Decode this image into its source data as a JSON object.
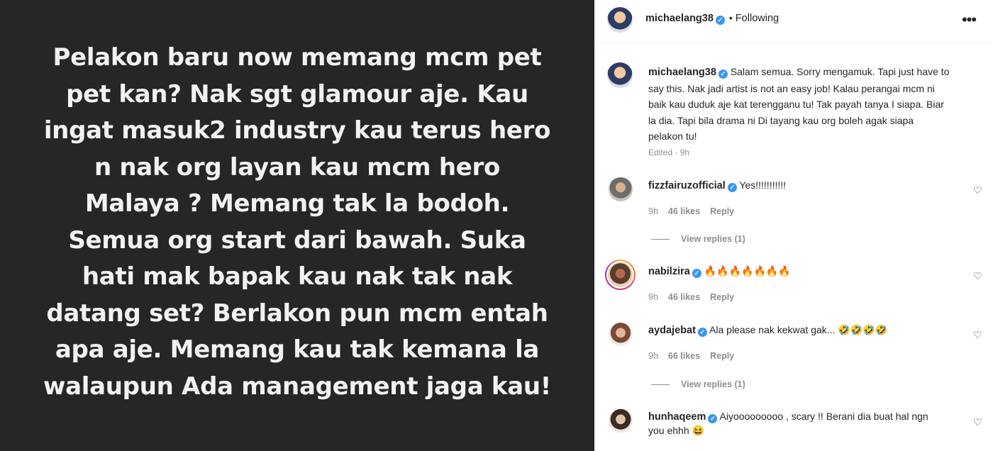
{
  "post_image": {
    "lines": [
      "Pelakon baru now memang mcm pet",
      "pet kan? Nak sgt glamour aje. Kau",
      "ingat masuk2 industry kau terus hero",
      "n nak org layan kau mcm hero",
      "Malaya ? Memang tak la bodoh.",
      "Semua org start dari bawah. Suka",
      "hati mak bapak kau nak tak nak",
      "datang set? Berlakon pun mcm entah",
      "apa aje.  Memang kau tak kemana la",
      "walaupun Ada management jaga kau!"
    ]
  },
  "header": {
    "username": "michaelang38",
    "verified_glyph": "✓",
    "separator": "•",
    "follow_status": "Following",
    "more_glyph": "•••"
  },
  "caption": {
    "username": "michaelang38",
    "lines": [
      "Salam semua. Sorry mengamuk. Tapi just have to",
      "say this. Nak jadi artist is not an easy job! Kalau perangai mcm ni",
      "baik kau duduk aje kat terengganu tu! Tak payah tanya I siapa. Biar",
      "la dia. Tapi bila drama ni Di tayang kau org boleh agak siapa",
      "pelakon tu!"
    ],
    "edited": "Edited · 9h"
  },
  "comments": [
    {
      "username": "fizzfairuzofficial",
      "text": "Yes!!!!!!!!!!!",
      "time": "9h",
      "likes": "46 likes",
      "reply": "Reply",
      "view_replies": "View replies (1)"
    },
    {
      "username": "nabilzira",
      "text": "🔥🔥🔥🔥🔥🔥🔥",
      "time": "9h",
      "likes": "46 likes",
      "reply": "Reply"
    },
    {
      "username": "aydajebat",
      "text": "Ala please nak kekwat gak... 🤣🤣🤣🤣",
      "time": "9h",
      "likes": "66 likes",
      "reply": "Reply",
      "view_replies": "View replies (1)"
    },
    {
      "username": "hunhaqeem",
      "lines": [
        "Aiyooooooooo , scary !! Berani dia buat hal ngn",
        "you ehhh 😆"
      ]
    }
  ],
  "icons": {
    "heart": "♡"
  }
}
